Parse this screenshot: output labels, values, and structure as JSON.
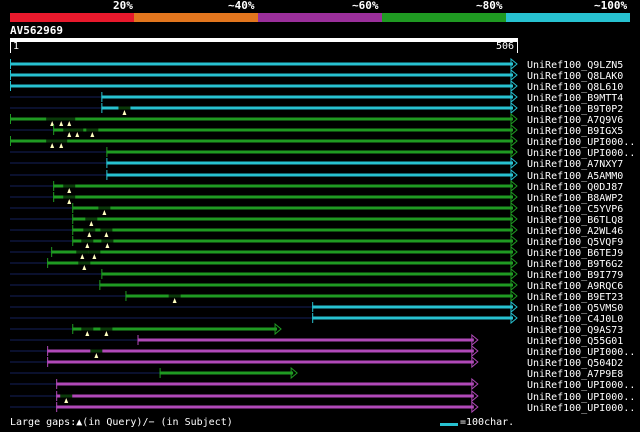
{
  "legend": {
    "labels": [
      "20%",
      "~40%",
      "~60%",
      "~80%",
      "~100%"
    ],
    "colors": [
      "#e8192c",
      "#e2761e",
      "#9b2f9b",
      "#1f9a22",
      "#27c1d0"
    ]
  },
  "query": {
    "id": "AV562969",
    "ruler_start": "1",
    "ruler_end": "506"
  },
  "axis": {
    "min": 1,
    "max": 506
  },
  "hits": [
    {
      "label": "UniRef100_Q9LZN5",
      "color": "cyan",
      "start": 1,
      "end": 506
    },
    {
      "label": "UniRef100_Q8LAK0",
      "color": "cyan",
      "start": 1,
      "end": 506
    },
    {
      "label": "UniRef100_Q8L610",
      "color": "cyan",
      "start": 1,
      "end": 506
    },
    {
      "label": "UniRef100_B9MTT4",
      "color": "cyan",
      "start": 92,
      "end": 506
    },
    {
      "label": "UniRef100_B9T0P2",
      "color": "cyan",
      "start": 92,
      "end": 506
    },
    {
      "label": "UniRef100_A7Q9V6",
      "color": "green",
      "start": 1,
      "end": 506
    },
    {
      "label": "UniRef100_B9IGX5",
      "color": "green",
      "start": 44,
      "end": 506
    },
    {
      "label": "UniRef100_UPI000..",
      "color": "green",
      "start": 1,
      "end": 506
    },
    {
      "label": "UniRef100_UPI000..",
      "color": "green",
      "start": 97,
      "end": 506
    },
    {
      "label": "UniRef100_A7NXY7",
      "color": "cyan",
      "start": 97,
      "end": 506
    },
    {
      "label": "UniRef100_A5AMM0",
      "color": "cyan",
      "start": 97,
      "end": 506
    },
    {
      "label": "UniRef100_Q0DJ87",
      "color": "green",
      "start": 44,
      "end": 506
    },
    {
      "label": "UniRef100_B8AWP2",
      "color": "green",
      "start": 44,
      "end": 506
    },
    {
      "label": "UniRef100_C5YVP6",
      "color": "green",
      "start": 63,
      "end": 506
    },
    {
      "label": "UniRef100_B6TLQ8",
      "color": "green",
      "start": 63,
      "end": 506
    },
    {
      "label": "UniRef100_A2WL46",
      "color": "green",
      "start": 63,
      "end": 506
    },
    {
      "label": "UniRef100_Q5VQF9",
      "color": "green",
      "start": 63,
      "end": 506
    },
    {
      "label": "UniRef100_B6TEJ9",
      "color": "green",
      "start": 42,
      "end": 506
    },
    {
      "label": "UniRef100_B9T6G2",
      "color": "green",
      "start": 38,
      "end": 506
    },
    {
      "label": "UniRef100_B9I779",
      "color": "green",
      "start": 92,
      "end": 506
    },
    {
      "label": "UniRef100_A9RQC6",
      "color": "green",
      "start": 90,
      "end": 506
    },
    {
      "label": "UniRef100_B9ET23",
      "color": "green",
      "start": 116,
      "end": 506
    },
    {
      "label": "UniRef100_Q5VMS0",
      "color": "cyan",
      "start": 302,
      "end": 506
    },
    {
      "label": "UniRef100_C4J0L0",
      "color": "cyan",
      "start": 302,
      "end": 506
    },
    {
      "label": "UniRef100_Q9AS73",
      "color": "green",
      "start": 63,
      "end": 271
    },
    {
      "label": "UniRef100_Q55G01",
      "color": "purple",
      "start": 128,
      "end": 467
    },
    {
      "label": "UniRef100_UPI000..",
      "color": "purple",
      "start": 38,
      "end": 467
    },
    {
      "label": "UniRef100_Q504D2",
      "color": "purple",
      "start": 38,
      "end": 467
    },
    {
      "label": "UniRef100_A7P9E8",
      "color": "green",
      "start": 150,
      "end": 287
    },
    {
      "label": "UniRef100_UPI000..",
      "color": "purple",
      "start": 47,
      "end": 467
    },
    {
      "label": "UniRef100_UPI000..",
      "color": "purple",
      "start": 47,
      "end": 467
    },
    {
      "label": "UniRef100_UPI000..",
      "color": "purple",
      "start": 47,
      "end": 467
    }
  ],
  "gaps": [
    {
      "row": 4,
      "positions": [
        115
      ]
    },
    {
      "row": 5,
      "positions": [
        43,
        52,
        60
      ]
    },
    {
      "row": 6,
      "positions": [
        60,
        68,
        83
      ]
    },
    {
      "row": 7,
      "positions": [
        43,
        52
      ]
    },
    {
      "row": 11,
      "positions": [
        60
      ]
    },
    {
      "row": 12,
      "positions": [
        60
      ]
    },
    {
      "row": 13,
      "positions": [
        95
      ]
    },
    {
      "row": 14,
      "positions": [
        82
      ]
    },
    {
      "row": 15,
      "positions": [
        80,
        97
      ]
    },
    {
      "row": 16,
      "positions": [
        78,
        98
      ]
    },
    {
      "row": 17,
      "positions": [
        73,
        85
      ]
    },
    {
      "row": 18,
      "positions": [
        75
      ]
    },
    {
      "row": 21,
      "positions": [
        165
      ]
    },
    {
      "row": 24,
      "positions": [
        78,
        97
      ]
    },
    {
      "row": 26,
      "positions": [
        87
      ]
    },
    {
      "row": 30,
      "positions": [
        57
      ]
    }
  ],
  "footer": {
    "gaps_text": "Large gaps:▲(in Query)/− (in Subject)",
    "scale_text": "=100char."
  }
}
